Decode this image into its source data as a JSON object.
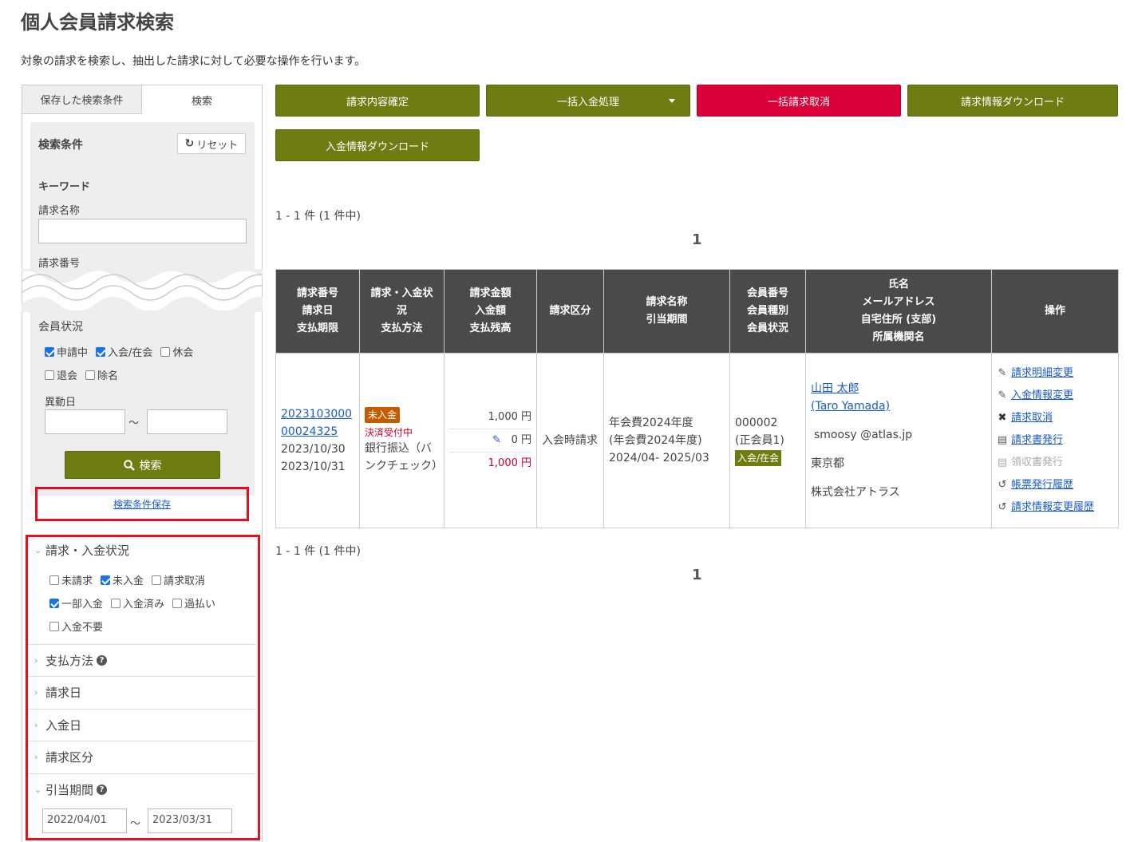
{
  "page": {
    "title": "個人会員請求検索",
    "description": "対象の請求を検索し、抽出した請求に対して必要な操作を行います。"
  },
  "sidebar": {
    "tabs": [
      {
        "label": "保存した検索条件"
      },
      {
        "label": "検索"
      }
    ],
    "conditions_title": "検索条件",
    "reset_label": "リセット",
    "keyword_label": "キーワード",
    "invoice_name_label": "請求名称",
    "invoice_name_value": "",
    "invoice_number_label": "請求番号",
    "member_status": {
      "label": "会員状況",
      "options": [
        {
          "label": "申請中",
          "checked": true
        },
        {
          "label": "入会/在会",
          "checked": true
        },
        {
          "label": "休会",
          "checked": false
        },
        {
          "label": "退会",
          "checked": false
        },
        {
          "label": "除名",
          "checked": false
        }
      ]
    },
    "change_date": {
      "label": "異動日",
      "from": "",
      "to": "",
      "tilde": "～"
    },
    "search_button": "検索",
    "save_conditions": "検索条件保存",
    "billing_status": {
      "label": "請求・入金状況",
      "options": [
        {
          "label": "未請求",
          "checked": false
        },
        {
          "label": "未入金",
          "checked": true
        },
        {
          "label": "請求取消",
          "checked": false
        },
        {
          "label": "一部入金",
          "checked": true
        },
        {
          "label": "入金済み",
          "checked": false
        },
        {
          "label": "過払い",
          "checked": false
        },
        {
          "label": "入金不要",
          "checked": false
        }
      ]
    },
    "payment_method_label": "支払方法",
    "invoice_date_label": "請求日",
    "deposit_date_label": "入金日",
    "invoice_type_label": "請求区分",
    "allocation_period": {
      "label": "引当期間",
      "from": "2022/04/01",
      "to": "2023/03/31",
      "tilde": "～"
    }
  },
  "actions": {
    "confirm": "請求内容確定",
    "bulk_payment": "一括入金処理",
    "bulk_cancel": "一括請求取消",
    "download_invoice": "請求情報ダウンロード",
    "download_payment": "入金情報ダウンロード"
  },
  "results": {
    "count_text": "1 - 1 件 (1 件中)",
    "page": "1"
  },
  "table": {
    "headers": [
      [
        "請求番号",
        "請求日",
        "支払期限"
      ],
      [
        "請求・入金状",
        "況",
        "支払方法"
      ],
      [
        "請求金額",
        "入金額",
        "支払残高"
      ],
      [
        "請求区分"
      ],
      [
        "請求名称",
        "引当期間"
      ],
      [
        "会員番号",
        "会員種別",
        "会員状況"
      ],
      [
        "氏名",
        "メールアドレス",
        "自宅住所 (支部)",
        "所属機関名"
      ],
      [
        "操作"
      ]
    ],
    "row": {
      "invoice_no_1": "2023103000",
      "invoice_no_2": "00024325",
      "invoice_date": "2023/10/30",
      "due_date": "2023/10/31",
      "status_badge": "未入金",
      "payment_status": "決済受付中",
      "payment_method": "銀行振込（バンクチェック）",
      "amount_billed": "1,000 円",
      "amount_paid": "0 円",
      "amount_remaining": "1,000 円",
      "invoice_type": "入会時請求",
      "invoice_name_1": "年会費2024年度",
      "invoice_name_2": "(年会費2024年度)",
      "period": "2024/04- 2025/03",
      "member_no": "000002",
      "member_type": "(正会員1)",
      "member_status": "入会/在会",
      "name": "山田 太郎",
      "name_en": "(Taro Yamada)",
      "email": "smoosy @atlas.jp",
      "address": "東京都",
      "org": "株式会社アトラス",
      "ops": [
        {
          "label": "請求明細変更",
          "icon": "pencil-icon",
          "glyph": "✎",
          "enabled": true
        },
        {
          "label": "入金情報変更",
          "icon": "pencil-icon",
          "glyph": "✎",
          "enabled": true
        },
        {
          "label": "請求取消",
          "icon": "x-icon",
          "glyph": "✖",
          "enabled": true
        },
        {
          "label": "請求書発行",
          "icon": "document-icon",
          "glyph": "▤",
          "enabled": true
        },
        {
          "label": "領収書発行",
          "icon": "document-icon",
          "glyph": "▤",
          "enabled": false
        },
        {
          "label": "帳票発行履歴",
          "icon": "history-icon",
          "glyph": "↺",
          "enabled": true
        },
        {
          "label": "請求情報変更履歴",
          "icon": "history-icon",
          "glyph": "↺",
          "enabled": true
        }
      ]
    }
  }
}
